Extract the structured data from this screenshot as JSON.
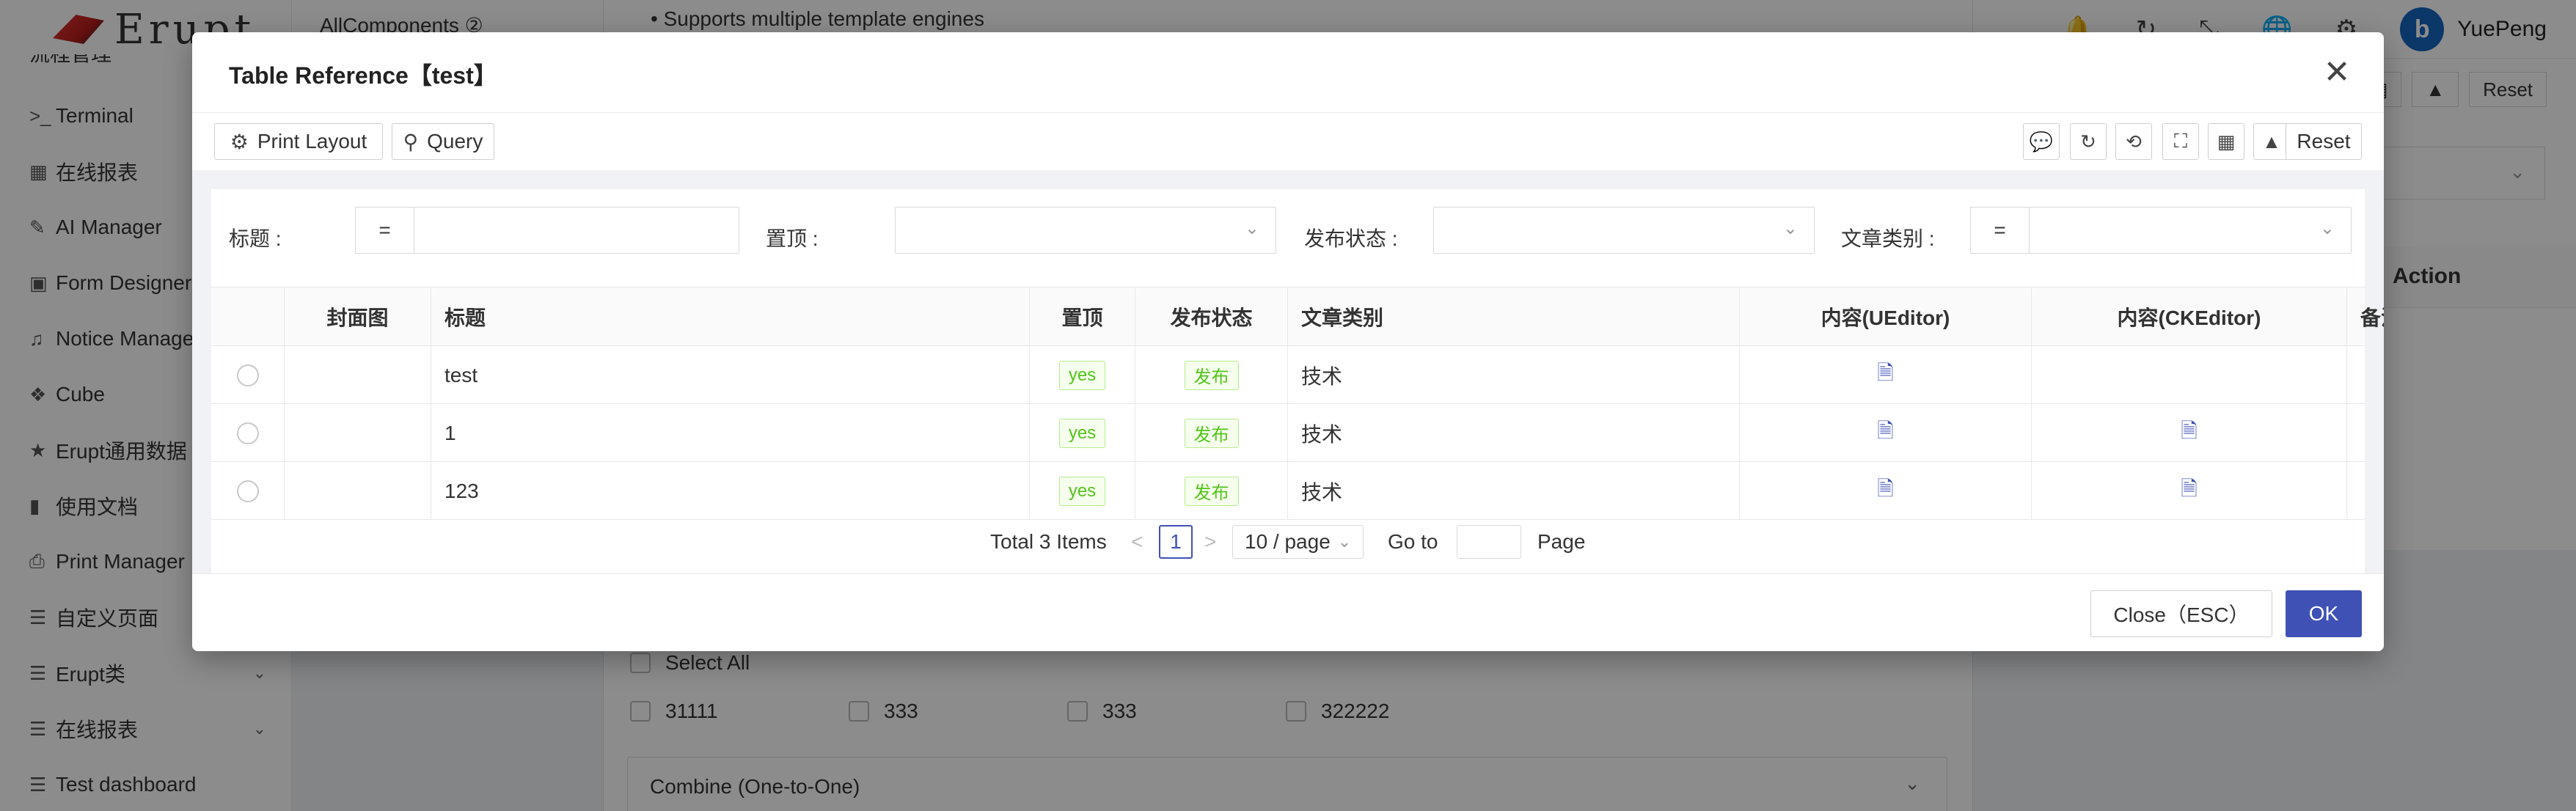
{
  "app": {
    "logo_text": "Erupt"
  },
  "sidebar": {
    "partial_item": "流程管理",
    "items": [
      {
        "icon": "terminal-icon",
        "glyph": ">_",
        "label": "Terminal",
        "caret": ""
      },
      {
        "icon": "table-icon",
        "glyph": "▦",
        "label": "在线报表",
        "caret": ""
      },
      {
        "icon": "magic-wand-icon",
        "glyph": "✎",
        "label": "AI Manager",
        "caret": ""
      },
      {
        "icon": "form-icon",
        "glyph": "▣",
        "label": "Form Designer",
        "caret": ""
      },
      {
        "icon": "bell-icon",
        "glyph": "♫",
        "label": "Notice Manager",
        "caret": ""
      },
      {
        "icon": "cubes-icon",
        "glyph": "❖",
        "label": "Cube",
        "caret": ""
      },
      {
        "icon": "star-icon",
        "glyph": "★",
        "label": "Erupt通用数据",
        "caret": ""
      },
      {
        "icon": "book-icon",
        "glyph": "▮",
        "label": "使用文档",
        "caret": ""
      },
      {
        "icon": "print-icon",
        "glyph": "⎙",
        "label": "Print Manager",
        "caret": ""
      },
      {
        "icon": "list-icon",
        "glyph": "☰",
        "label": "自定义页面",
        "caret": ""
      },
      {
        "icon": "list-icon",
        "glyph": "☰",
        "label": "Erupt类",
        "caret": "⌄"
      },
      {
        "icon": "list-icon",
        "glyph": "☰",
        "label": "在线报表",
        "caret": "⌄"
      },
      {
        "icon": "list-icon",
        "glyph": "☰",
        "label": "Test dashboard",
        "caret": ""
      }
    ]
  },
  "topbar": {
    "title": "AllComponents ②",
    "icons": [
      "bell-icon",
      "refresh-icon",
      "collapse-icon",
      "globe-icon",
      "gear-icon"
    ],
    "icon_glyphs": [
      "🔔",
      "↻",
      "⤡",
      "🌐",
      "⚙"
    ],
    "user_name": "YuePeng",
    "avatar_letter": "b"
  },
  "background": {
    "feature_text": "• Supports multiple template engines",
    "right_tools": [
      "▦",
      "▲",
      "Reset"
    ],
    "action_header": "Action",
    "select_all": "Select All",
    "checkbox_items": [
      "31111",
      "333",
      "333",
      "322222"
    ],
    "combine_label": "Combine (One-to-One)"
  },
  "modal": {
    "title": "Table Reference【test】",
    "toolbar": {
      "print_layout": "Print Layout",
      "query": "Query",
      "reset": "Reset",
      "tool_icons": [
        "comment-icon",
        "refresh-icon",
        "history-icon",
        "fullscreen-icon",
        "table-icon",
        "caret-up-icon"
      ],
      "tool_glyphs": [
        "💬",
        "↻",
        "⟲",
        "⛶",
        "▦",
        "▲"
      ]
    },
    "search": {
      "title_label": "标题 :",
      "title_op": "=",
      "pin_label": "置顶 :",
      "status_label": "发布状态 :",
      "category_label": "文章类别 :",
      "category_op": "="
    },
    "table": {
      "columns": [
        "",
        "封面图",
        "标题",
        "置顶",
        "发布状态",
        "文章类别",
        "内容(UEditor)",
        "内容(CKEditor)",
        "备注"
      ],
      "rows": [
        {
          "cover": "",
          "title": "test",
          "pin": "yes",
          "status": "发布",
          "category": "技术",
          "ueditor": true,
          "ckeditor": false,
          "remark": ""
        },
        {
          "cover": "",
          "title": "1",
          "pin": "yes",
          "status": "发布",
          "category": "技术",
          "ueditor": true,
          "ckeditor": true,
          "remark": ""
        },
        {
          "cover": "",
          "title": "123",
          "pin": "yes",
          "status": "发布",
          "category": "技术",
          "ueditor": true,
          "ckeditor": true,
          "remark": ""
        }
      ]
    },
    "pagination": {
      "total": "Total 3 Items",
      "prev": "<",
      "current": "1",
      "next": ">",
      "page_size": "10 / page",
      "goto": "Go to",
      "page": "Page"
    },
    "footer": {
      "close": "Close（ESC）",
      "ok": "OK"
    }
  }
}
